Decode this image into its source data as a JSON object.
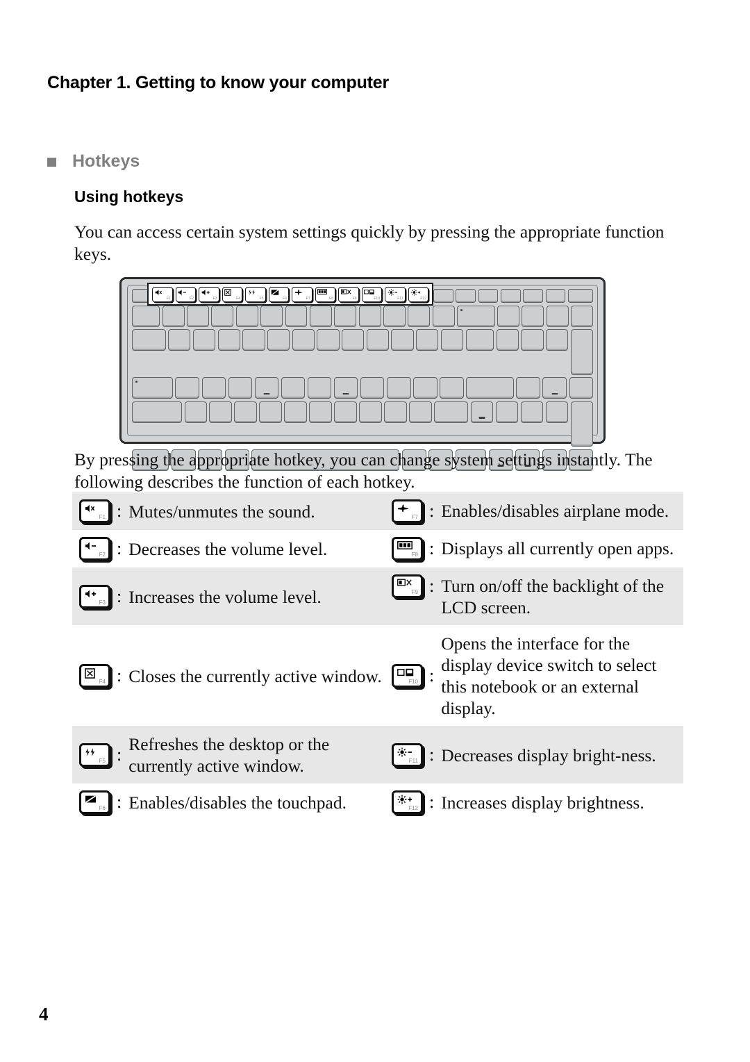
{
  "document": {
    "chapter_heading": "Chapter 1. Getting to know your computer",
    "section_title": "Hotkeys",
    "subsection_title": "Using hotkeys",
    "intro_paragraph": "You can access certain system settings quickly by pressing the appropriate function keys.",
    "mid_paragraph": "By pressing the appropriate hotkey, you can change system settings instantly. The following describes the function of each hotkey.",
    "page_number": "4"
  },
  "colors": {
    "section_title": "#808080",
    "bullet": "#808080",
    "row_shade": "#e7e7e7",
    "keyboard_body": "#d2d5d7",
    "keyboard_key": "#cbcfd1",
    "text": "#111111"
  },
  "keyboard_figure": {
    "name": "laptop-keyboard-diagram",
    "callout_label": "function-key-row-highlight",
    "function_keys": [
      {
        "f": "F1",
        "glyph": "⌨",
        "icon": "mute-icon"
      },
      {
        "f": "F2",
        "glyph": "◂–",
        "icon": "volume-down-icon"
      },
      {
        "f": "F3",
        "glyph": "◂+",
        "icon": "volume-up-icon"
      },
      {
        "f": "F4",
        "glyph": "⌧",
        "icon": "close-window-icon"
      },
      {
        "f": "F5",
        "glyph": "↻",
        "icon": "refresh-icon"
      },
      {
        "f": "F6",
        "glyph": "▭",
        "icon": "touchpad-icon"
      },
      {
        "f": "F7",
        "glyph": "✈",
        "icon": "airplane-mode-icon"
      },
      {
        "f": "F8",
        "glyph": "▤",
        "icon": "task-view-icon"
      },
      {
        "f": "F9",
        "glyph": "□X",
        "icon": "lcd-backlight-icon"
      },
      {
        "f": "F10",
        "glyph": "□■",
        "icon": "display-switch-icon"
      },
      {
        "f": "F11",
        "glyph": "☀–",
        "icon": "brightness-down-icon"
      },
      {
        "f": "F12",
        "glyph": "☀+",
        "icon": "brightness-up-icon"
      }
    ]
  },
  "hotkey_table": {
    "separator": ":",
    "rows": [
      {
        "shaded": true,
        "left": {
          "fkey": "F1",
          "icon": "mute-icon",
          "description": "Mutes/unmutes the sound."
        },
        "right": {
          "fkey": "F7",
          "icon": "airplane-mode-icon",
          "description": "Enables/disables airplane mode."
        }
      },
      {
        "shaded": false,
        "left": {
          "fkey": "F2",
          "icon": "volume-down-icon",
          "description": "Decreases the volume level."
        },
        "right": {
          "fkey": "F8",
          "icon": "task-view-icon",
          "description": "Displays all currently open apps."
        }
      },
      {
        "shaded": true,
        "left": {
          "fkey": "F3",
          "icon": "volume-up-icon",
          "description": "Increases the volume level."
        },
        "right": {
          "fkey": "F9",
          "icon": "lcd-backlight-icon",
          "description": "Turn on/off the backlight of the LCD screen."
        }
      },
      {
        "shaded": false,
        "left": {
          "fkey": "F4",
          "icon": "close-window-icon",
          "description": "Closes the currently active window."
        },
        "right": {
          "fkey": "F10",
          "icon": "display-switch-icon",
          "description": "Opens the interface for the display device switch to select this notebook or an external display."
        }
      },
      {
        "shaded": true,
        "left": {
          "fkey": "F5",
          "icon": "refresh-icon",
          "description": "Refreshes the desktop or the currently active window."
        },
        "right": {
          "fkey": "F11",
          "icon": "brightness-down-icon",
          "description": "Decreases display bright-ness."
        }
      },
      {
        "shaded": false,
        "left": {
          "fkey": "F6",
          "icon": "touchpad-icon",
          "description": "Enables/disables the touchpad."
        },
        "right": {
          "fkey": "F12",
          "icon": "brightness-up-icon",
          "description": "Increases display brightness."
        }
      }
    ]
  }
}
